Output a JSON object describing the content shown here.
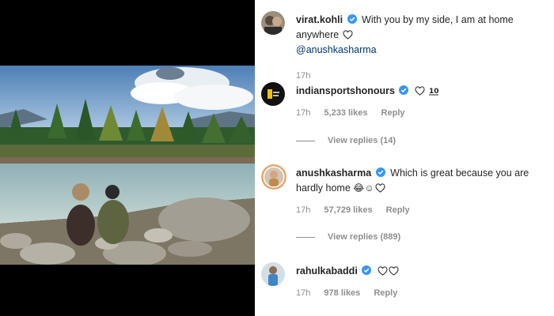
{
  "post": {
    "caption_author": "virat.kohli",
    "caption_text": "With you by my side, I am at home anywhere",
    "caption_emoji": "heart-outline",
    "caption_mention": "@anushkasharma",
    "caption_time": "17h"
  },
  "comments": [
    {
      "username": "indiansportshonours",
      "verified": true,
      "text": "",
      "emojis": [
        "heart-outline",
        "hundred-points"
      ],
      "time": "17h",
      "likes": "5,233 likes",
      "reply_label": "Reply",
      "view_replies": "View replies (14)"
    },
    {
      "username": "anushkasharma",
      "verified": true,
      "text": "Which is great because you are hardly home",
      "emojis": [
        "laughing-face",
        "smiling-face",
        "heart-outline"
      ],
      "time": "17h",
      "likes": "57,729 likes",
      "reply_label": "Reply",
      "view_replies": "View replies (889)"
    },
    {
      "username": "rahulkabaddi",
      "verified": true,
      "text": "",
      "emojis": [
        "heart-outline",
        "heart-outline"
      ],
      "time": "17h",
      "likes": "978 likes",
      "reply_label": "Reply"
    }
  ],
  "colors": {
    "verified_blue": "#3897f0",
    "text": "#262626",
    "muted": "#8e8e8e",
    "mention": "#00376b"
  }
}
